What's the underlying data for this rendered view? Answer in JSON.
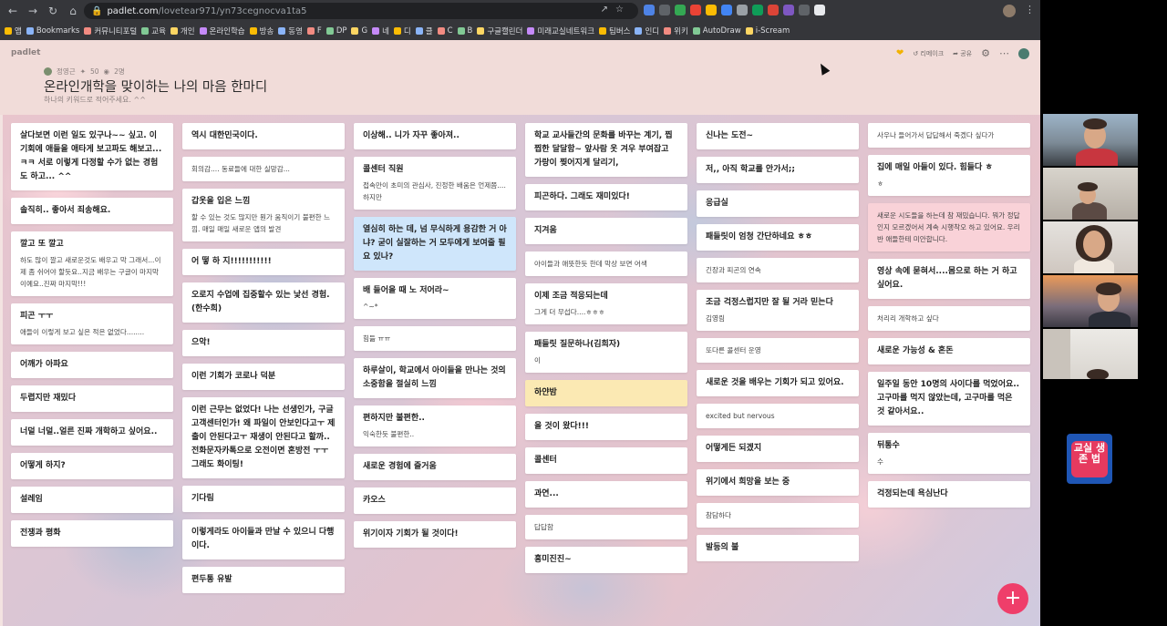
{
  "browser": {
    "url_host": "padlet.com",
    "url_path": "/lovetear971/yn73cegnocva1ta5",
    "bookmarks": [
      "앱",
      "Bookmarks",
      "커뮤니티포털",
      "교육",
      "개인",
      "온라인학습",
      "방송",
      "동영",
      "F",
      "DP",
      "G",
      "네",
      "디",
      "클",
      "C",
      "B",
      "구글캘린더",
      "미래교실네트워크",
      "팀버스",
      "인디",
      "위키",
      "AutoDraw",
      "i-Scream"
    ]
  },
  "padlet": {
    "logo": "padlet",
    "author": "정영근",
    "likes": "50",
    "comments": "2명",
    "title": "온라인개학을 맞이하는 나의 마음 한마디",
    "subtitle": "하나의 키워드로 적어주세요. ^^",
    "remake_label": "리메이크",
    "share_label": "공유",
    "add_label": "+"
  },
  "columns": [
    [
      {
        "t": "살다보면 이런 일도 있구나~~ 싶고. 이 기회에 애들을 애타게 보고파도 해보고... ㅋㅋ 서로 이렇게 다정할 수가 없는 경험도 하고... ^^",
        "b": ""
      },
      {
        "t": "솔직히.. 좋아서 죄송해요.",
        "b": ""
      },
      {
        "t": "깔고 또 깔고",
        "b": "하도 많이 깔고 새로운것도 배우고 막 그래서...이제 좀 쉬어야 할듯요..지금 배우는 구글이 마지막이예요..진짜 마지막!!!"
      },
      {
        "t": "피곤 ㅜㅜ",
        "b": "애들이 이렇게 보고 싶은 적은 없었다........"
      },
      {
        "t": "어깨가 아파요",
        "b": ""
      },
      {
        "t": "두렵지만 재밌다",
        "b": ""
      },
      {
        "t": "너덜 너덜..얼른 진짜 개학하고 싶어요..",
        "b": ""
      },
      {
        "t": "어떻게 하지?",
        "b": ""
      },
      {
        "t": "설레임",
        "b": ""
      },
      {
        "t": "전쟁과 평화",
        "b": ""
      }
    ],
    [
      {
        "t": "역시 대한민국이다.",
        "b": ""
      },
      {
        "t": "",
        "b": "회의감.... 동료들에 대한 실망감..."
      },
      {
        "t": "갑옷을 입은 느낌",
        "b": "할 수 있는 것도 많지만 뭔가 움직이기 불편한 느낌. 매일 매일 새로운 앱의 발견"
      },
      {
        "t": "어 떻 하 지!!!!!!!!!!!",
        "b": ""
      },
      {
        "t": "오로지 수업에 집중할수 있는 낯선 경험.(한수희)",
        "b": ""
      },
      {
        "t": "으악!",
        "b": ""
      },
      {
        "t": "이런 기회가 코로나 덕분",
        "b": ""
      },
      {
        "t": "이런 근무는 없었다! 나는 선생인가, 구글 고객센터인가! 왜 파일이 안보인다고ㅜ 제출이 안된다고ㅜ 재생이 안된다고 할까.. 전화문자카톡으로 오전이면 혼방전 ㅜㅜ그래도 화이팅!",
        "b": ""
      },
      {
        "t": "기다림",
        "b": ""
      },
      {
        "t": "이렇게라도 아이들과 만날 수 있으니 다행이다.",
        "b": ""
      },
      {
        "t": "편두통 유발",
        "b": ""
      }
    ],
    [
      {
        "t": "이상해.. 니가 자꾸 좋아져..",
        "b": ""
      },
      {
        "t": "콜센터 직원",
        "b": "접속만이 초미의 관심사, 진정한 배움은 언제쯤.... 하지만"
      },
      {
        "t": "열심히 하는 데, 넘 무식하게 용감한 거 아냐? 굳이 실잘하는 거 모두에게 보여줄 필요 있나?",
        "b": "",
        "c": "blue"
      },
      {
        "t": "배 들어올 때 노 저어라~",
        "b": "^~*"
      },
      {
        "t": "",
        "b": "힘듦 ㅠㅠ"
      },
      {
        "t": "하루살이, 학교에서 아이들을 만나는 것의 소중함을 절실히 느낌",
        "b": ""
      },
      {
        "t": "편하지만 불편한..",
        "b": "익숙한듯 불편한.."
      },
      {
        "t": "새로운 경험에 즐거움",
        "b": ""
      },
      {
        "t": "카오스",
        "b": ""
      },
      {
        "t": "위기이자 기회가 될 것이다!",
        "b": ""
      }
    ],
    [
      {
        "t": "학교 교사들간의 문화를 바꾸는 계기, 찝찝한 달달함~ 앞사람 옷 겨우 부여잡고 가랑이 찢어지게 달리기,",
        "b": ""
      },
      {
        "t": "피곤하다. 그래도 재미있다!",
        "b": ""
      },
      {
        "t": "지겨움",
        "b": ""
      },
      {
        "t": "",
        "b": "아이들과 애뜻한듯 한데 막상 보면 어색"
      },
      {
        "t": "이제 조금 적응되는데",
        "b": "그게 더 무섭다....ㅎㅎㅎ"
      },
      {
        "t": "패들릿 질문하나(김희자)",
        "b": "이"
      },
      {
        "t": "하얀밤",
        "b": "",
        "c": "yellow"
      },
      {
        "t": "올 것이 왔다!!!",
        "b": ""
      },
      {
        "t": "콜센터",
        "b": ""
      },
      {
        "t": "과연...",
        "b": ""
      },
      {
        "t": "",
        "b": "답답함"
      },
      {
        "t": "흥미진진~",
        "b": ""
      }
    ],
    [
      {
        "t": "신나는 도전~",
        "b": ""
      },
      {
        "t": "저,, 아직 학교를 안가서;;",
        "b": ""
      },
      {
        "t": "응급실",
        "b": ""
      },
      {
        "t": "패들릿이 엄청 간단하네요 ㅎㅎ",
        "b": ""
      },
      {
        "t": "",
        "b": "긴장과 피곤의 연속"
      },
      {
        "t": "조금 걱정스럽지만 잘 될 거라 믿는다",
        "b": "김영림"
      },
      {
        "t": "",
        "b": "또다른 콜센터 운영"
      },
      {
        "t": "새로운 것을 배우는 기회가 되고 있어요.",
        "b": ""
      },
      {
        "t": "",
        "b": "excited but nervous"
      },
      {
        "t": "어떻게든 되겠지",
        "b": ""
      },
      {
        "t": "위기에서 희망을 보는 중",
        "b": ""
      },
      {
        "t": "",
        "b": "참담하다"
      },
      {
        "t": "발등의 불",
        "b": ""
      }
    ],
    [
      {
        "t": "",
        "b": "사우나 들어가서 답답해서 죽겠다 싶다가"
      },
      {
        "t": "집에 매일 아들이 있다. 힘들다 ㅎ",
        "b": "ㅎ"
      },
      {
        "t": "",
        "b": "새로운 시도들을 하는데 참 재밌습니다. 뭐가 정답인지 모르겠어서 계속 시행착오 하고 있어요. 우리 반 애들한테 미안합니다.",
        "c": "pink"
      },
      {
        "t": "영상 속에 묻혀서....몸으로 하는 거 하고 싶어요.",
        "b": ""
      },
      {
        "t": "",
        "b": "처리리 개학하고 싶다"
      },
      {
        "t": "새로운 가능성 & 혼돈",
        "b": ""
      },
      {
        "t": "일주일 동안 10명의 사이다를 먹었어요.. 고구마를 먹지 않았는데, 고구마를 먹은 것 같아서요..",
        "b": ""
      },
      {
        "t": "뒤통수",
        "b": "수"
      },
      {
        "t": "걱정되는데 욕심난다",
        "b": ""
      }
    ]
  ],
  "side_logo_text": "교실 생존 법"
}
